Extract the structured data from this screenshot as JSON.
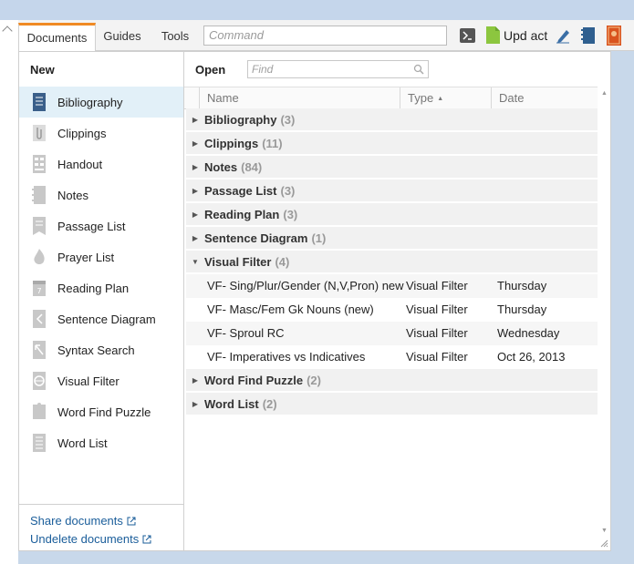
{
  "toolbar": {
    "tabs": [
      {
        "label": "Documents",
        "active": true
      },
      {
        "label": "Guides",
        "active": false
      },
      {
        "label": "Tools",
        "active": false
      }
    ],
    "command_placeholder": "Command",
    "update_label": "Upd act",
    "icons": [
      "terminal-icon",
      "document-update-icon",
      "pen-icon",
      "notebook-icon",
      "library-icon"
    ]
  },
  "left": {
    "new_label": "New",
    "items": [
      {
        "label": "Bibliography",
        "icon": "bibliography-icon",
        "selected": true
      },
      {
        "label": "Clippings",
        "icon": "paperclip-icon",
        "selected": false
      },
      {
        "label": "Handout",
        "icon": "handout-icon",
        "selected": false
      },
      {
        "label": "Notes",
        "icon": "notes-icon",
        "selected": false
      },
      {
        "label": "Passage List",
        "icon": "passage-list-icon",
        "selected": false
      },
      {
        "label": "Prayer List",
        "icon": "flame-icon",
        "selected": false
      },
      {
        "label": "Reading Plan",
        "icon": "calendar-icon",
        "selected": false
      },
      {
        "label": "Sentence Diagram",
        "icon": "sentence-diagram-icon",
        "selected": false
      },
      {
        "label": "Syntax Search",
        "icon": "syntax-search-icon",
        "selected": false
      },
      {
        "label": "Visual Filter",
        "icon": "visual-filter-icon",
        "selected": false
      },
      {
        "label": "Word Find Puzzle",
        "icon": "puzzle-icon",
        "selected": false
      },
      {
        "label": "Word List",
        "icon": "word-list-icon",
        "selected": false
      }
    ],
    "footer": {
      "share_label": "Share documents",
      "undelete_label": "Undelete documents"
    }
  },
  "right": {
    "open_label": "Open",
    "find_placeholder": "Find",
    "columns": {
      "name": "Name",
      "type": "Type",
      "date": "Date"
    },
    "groups_before": [
      {
        "name": "Bibliography",
        "count": "(3)"
      },
      {
        "name": "Clippings",
        "count": "(11)"
      },
      {
        "name": "Notes",
        "count": "(84)"
      },
      {
        "name": "Passage List",
        "count": "(3)"
      },
      {
        "name": "Reading Plan",
        "count": "(3)"
      },
      {
        "name": "Sentence Diagram",
        "count": "(1)"
      }
    ],
    "expanded_group": {
      "name": "Visual Filter",
      "count": "(4)"
    },
    "documents": [
      {
        "name": "VF- Sing/Plur/Gender (N,V,Pron) new",
        "type": "Visual Filter",
        "date": "Thursday"
      },
      {
        "name": "VF- Masc/Fem Gk Nouns (new)",
        "type": "Visual Filter",
        "date": "Thursday"
      },
      {
        "name": "VF- Sproul RC",
        "type": "Visual Filter",
        "date": "Wednesday"
      },
      {
        "name": "VF- Imperatives vs Indicatives",
        "type": "Visual Filter",
        "date": "Oct 26, 2013"
      }
    ],
    "groups_after": [
      {
        "name": "Word Find Puzzle",
        "count": "(2)"
      },
      {
        "name": "Word List",
        "count": "(2)"
      }
    ]
  },
  "colors": {
    "accent_tab": "#f08a24",
    "link": "#1a5d9a",
    "selected_bg": "#e2f0f8"
  }
}
